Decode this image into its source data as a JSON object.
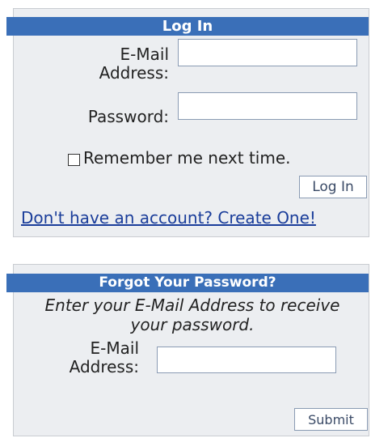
{
  "login": {
    "header": "Log In",
    "email_label_line1": "E-Mail",
    "email_label_line2": "Address:",
    "email_value": "",
    "password_label": "Password:",
    "password_value": "",
    "remember_label": "Remember me next time.",
    "remember_checked": false,
    "login_button": "Log In",
    "create_account_link": "Don't have an account? Create One!"
  },
  "forgot": {
    "header": "Forgot Your Password?",
    "instructions_line1": "Enter your E-Mail Address to receive",
    "instructions_line2": "your password.",
    "email_label_line1": "E-Mail",
    "email_label_line2": "Address:",
    "email_value": "",
    "submit_button": "Submit"
  },
  "colors": {
    "header_bg": "#3a6fb8",
    "panel_bg": "#eceef1",
    "link": "#1a3d9a"
  }
}
